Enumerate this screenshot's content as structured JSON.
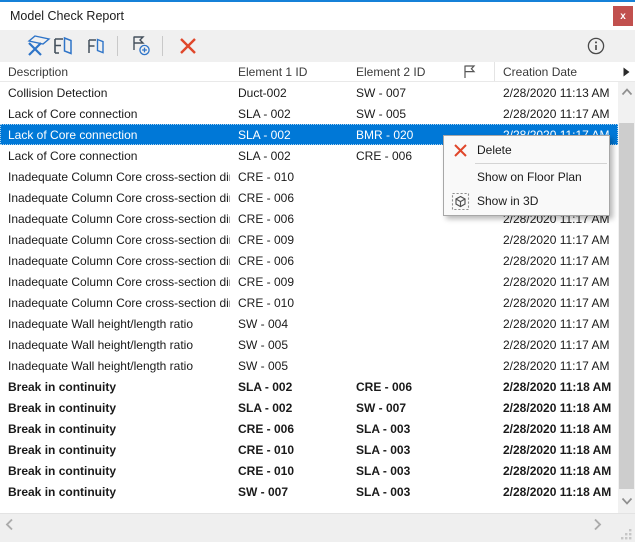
{
  "window": {
    "title": "Model Check Report",
    "close_glyph": "x"
  },
  "toolbar": {
    "buttons": [
      {
        "icon": "model-check-3d-icon"
      },
      {
        "icon": "element-1-3d-icon"
      },
      {
        "icon": "element-2-3d-icon"
      },
      {
        "icon": "flag-add-icon"
      },
      {
        "icon": "delete-x-icon"
      }
    ],
    "info": {
      "icon": "info-icon"
    }
  },
  "table": {
    "columns": {
      "description": "Description",
      "element1": "Element 1 ID",
      "element2": "Element 2 ID",
      "flag": "",
      "creation_date": "Creation Date"
    },
    "rows": [
      {
        "description": "Collision Detection",
        "element1": "Duct-002",
        "element2": "SW - 007",
        "date": "2/28/2020 11:13 AM",
        "bold": false,
        "selected": false
      },
      {
        "description": "Lack of Core connection",
        "element1": "SLA - 002",
        "element2": "SW - 005",
        "date": "2/28/2020 11:17 AM",
        "bold": false,
        "selected": false
      },
      {
        "description": "Lack of Core connection",
        "element1": "SLA - 002",
        "element2": "BMR - 020",
        "date": "2/28/2020 11:17 AM",
        "bold": false,
        "selected": true
      },
      {
        "description": "Lack of Core connection",
        "element1": "SLA - 002",
        "element2": "CRE - 006",
        "date": "",
        "bold": false,
        "selected": false
      },
      {
        "description": "Inadequate Column Core cross-section dim...",
        "element1": "CRE - 010",
        "element2": "",
        "date": "",
        "bold": false,
        "selected": false
      },
      {
        "description": "Inadequate Column Core cross-section dim...",
        "element1": "CRE - 006",
        "element2": "",
        "date": "",
        "bold": false,
        "selected": false
      },
      {
        "description": "Inadequate Column Core cross-section dim...",
        "element1": "CRE - 006",
        "element2": "",
        "date": "2/28/2020 11:17 AM",
        "bold": false,
        "selected": false
      },
      {
        "description": "Inadequate Column Core cross-section dim...",
        "element1": "CRE - 009",
        "element2": "",
        "date": "2/28/2020 11:17 AM",
        "bold": false,
        "selected": false
      },
      {
        "description": "Inadequate Column Core cross-section dim...",
        "element1": "CRE - 006",
        "element2": "",
        "date": "2/28/2020 11:17 AM",
        "bold": false,
        "selected": false
      },
      {
        "description": "Inadequate Column Core cross-section dim...",
        "element1": "CRE - 009",
        "element2": "",
        "date": "2/28/2020 11:17 AM",
        "bold": false,
        "selected": false
      },
      {
        "description": "Inadequate Column Core cross-section dim...",
        "element1": "CRE - 010",
        "element2": "",
        "date": "2/28/2020 11:17 AM",
        "bold": false,
        "selected": false
      },
      {
        "description": "Inadequate Wall height/length ratio",
        "element1": "SW - 004",
        "element2": "",
        "date": "2/28/2020 11:17 AM",
        "bold": false,
        "selected": false
      },
      {
        "description": "Inadequate Wall height/length ratio",
        "element1": "SW - 005",
        "element2": "",
        "date": "2/28/2020 11:17 AM",
        "bold": false,
        "selected": false
      },
      {
        "description": "Inadequate Wall height/length ratio",
        "element1": "SW - 005",
        "element2": "",
        "date": "2/28/2020 11:17 AM",
        "bold": false,
        "selected": false
      },
      {
        "description": "Break in continuity",
        "element1": "SLA - 002",
        "element2": "CRE - 006",
        "date": "2/28/2020 11:18 AM",
        "bold": true,
        "selected": false
      },
      {
        "description": "Break in continuity",
        "element1": "SLA - 002",
        "element2": "SW - 007",
        "date": "2/28/2020 11:18 AM",
        "bold": true,
        "selected": false
      },
      {
        "description": "Break in continuity",
        "element1": "CRE - 006",
        "element2": "SLA - 003",
        "date": "2/28/2020 11:18 AM",
        "bold": true,
        "selected": false
      },
      {
        "description": "Break in continuity",
        "element1": "CRE - 010",
        "element2": "SLA - 003",
        "date": "2/28/2020 11:18 AM",
        "bold": true,
        "selected": false
      },
      {
        "description": "Break in continuity",
        "element1": "CRE - 010",
        "element2": "SLA - 003",
        "date": "2/28/2020 11:18 AM",
        "bold": true,
        "selected": false
      },
      {
        "description": "Break in continuity",
        "element1": "SW - 007",
        "element2": "SLA - 003",
        "date": "2/28/2020 11:18 AM",
        "bold": true,
        "selected": false
      }
    ]
  },
  "context_menu": {
    "items": [
      {
        "label": "Delete",
        "icon": "delete-x-icon"
      },
      {
        "label": "Show on Floor Plan",
        "icon": ""
      },
      {
        "label": "Show in 3D",
        "icon": "show-in-3d-icon"
      }
    ]
  },
  "colors": {
    "accent_blue": "#0078d7",
    "title_border_blue": "#1581d8",
    "close_red": "#c1504e",
    "icon_blue": "#2e74c8",
    "delete_red": "#e0472b"
  }
}
